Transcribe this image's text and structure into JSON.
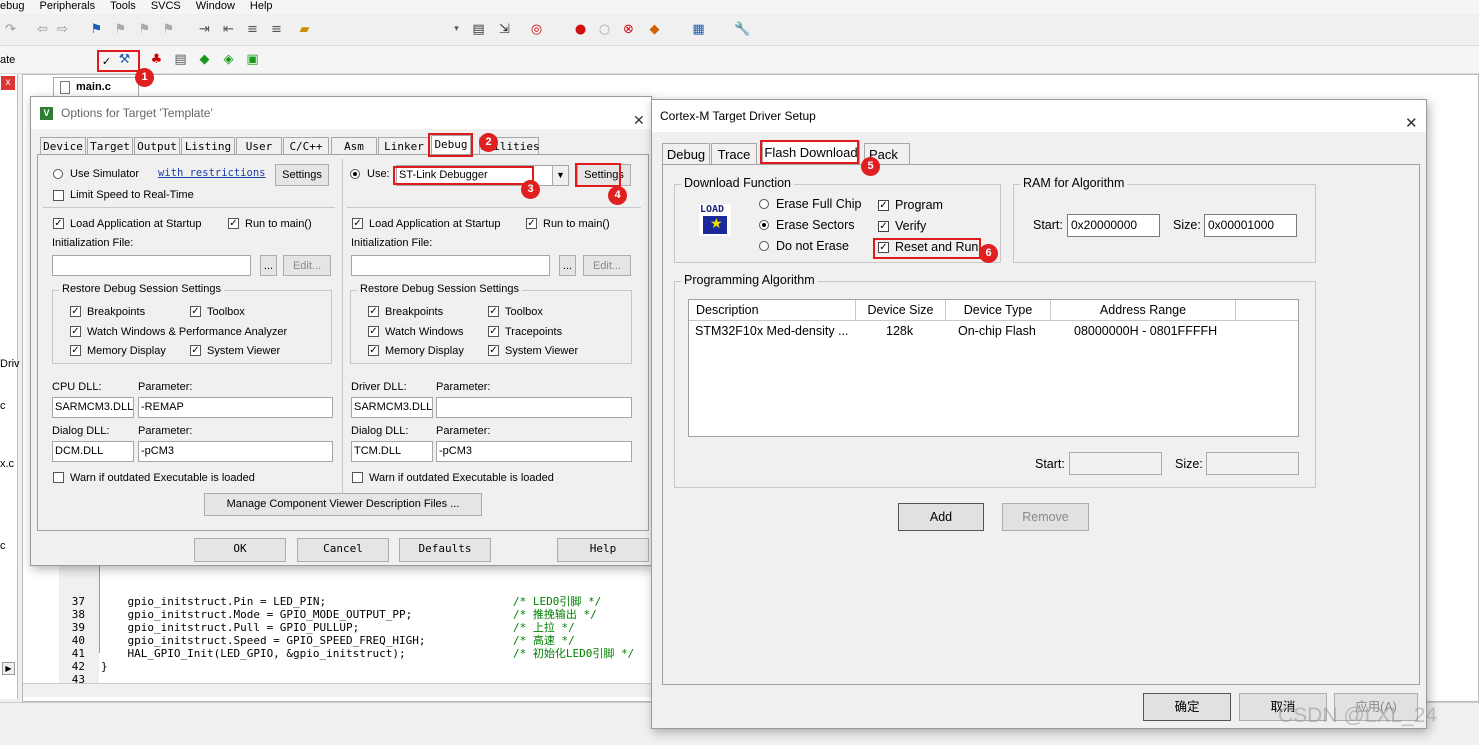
{
  "menu": [
    "ebug",
    "Peripherals",
    "Tools",
    "SVCS",
    "Window",
    "Help"
  ],
  "toolbar2": {
    "target_name": "ate"
  },
  "editor": {
    "tab_name": "main.c",
    "line_numbers": [
      "37",
      "38",
      "39",
      "40",
      "41",
      "42",
      "43"
    ],
    "code_lines": [
      "    gpio_initstruct.Pin = LED_PIN;",
      "    gpio_initstruct.Mode = GPIO_MODE_OUTPUT_PP;",
      "    gpio_initstruct.Pull = GPIO_PULLUP;",
      "    gpio_initstruct.Speed = GPIO_SPEED_FREQ_HIGH;",
      "    HAL_GPIO_Init(LED_GPIO, &gpio_initstruct);",
      "}",
      ""
    ],
    "comments": [
      "/* LED0引脚 */",
      "/* 推挽输出 */",
      "/* 上拉 */",
      "/* 高速 */",
      "/* 初始化LED0引脚 */"
    ],
    "left_fragments": [
      "Driv",
      "c",
      "x.c",
      "c"
    ]
  },
  "options_dialog": {
    "title": "Options for Target 'Template'",
    "tabs": [
      "Device",
      "Target",
      "Output",
      "Listing",
      "User",
      "C/C++",
      "Asm",
      "Linker",
      "Debug",
      "Utilities"
    ],
    "left": {
      "use_simulator": "Use Simulator",
      "with_restrictions": "with restrictions",
      "settings": "Settings",
      "limit_speed": "Limit Speed to Real-Time",
      "load_app": "Load Application at Startup",
      "run_to_main": "Run to main()",
      "init_file": "Initialization File:",
      "browse": "...",
      "edit": "Edit...",
      "restore": "Restore Debug Session Settings",
      "breakpoints": "Breakpoints",
      "toolbox": "Toolbox",
      "watch": "Watch Windows & Performance Analyzer",
      "memory": "Memory Display",
      "sysviewer": "System Viewer",
      "cpu_dll": "CPU DLL:",
      "parameter": "Parameter:",
      "cpu_dll_val": "SARMCM3.DLL",
      "cpu_param_val": "-REMAP",
      "dialog_dll": "Dialog DLL:",
      "dialog_dll_val": "DCM.DLL",
      "dialog_param_val": "-pCM3",
      "warn": "Warn if outdated Executable is loaded"
    },
    "right": {
      "use": "Use:",
      "debugger": "ST-Link Debugger",
      "settings": "Settings",
      "load_app": "Load Application at Startup",
      "run_to_main": "Run to main()",
      "init_file": "Initialization File:",
      "browse": "...",
      "edit": "Edit...",
      "restore": "Restore Debug Session Settings",
      "breakpoints": "Breakpoints",
      "toolbox": "Toolbox",
      "watch": "Watch Windows",
      "tracepoints": "Tracepoints",
      "memory": "Memory Display",
      "sysviewer": "System Viewer",
      "driver_dll": "Driver DLL:",
      "parameter": "Parameter:",
      "driver_dll_val": "SARMCM3.DLL",
      "driver_param_val": "",
      "dialog_dll": "Dialog DLL:",
      "dialog_dll_val": "TCM.DLL",
      "dialog_param_val": "-pCM3",
      "warn": "Warn if outdated Executable is loaded"
    },
    "manage": "Manage Component Viewer Description Files ...",
    "buttons": {
      "ok": "OK",
      "cancel": "Cancel",
      "defaults": "Defaults",
      "help": "Help"
    }
  },
  "cortex_dialog": {
    "title": "Cortex-M Target Driver Setup",
    "tabs": [
      "Debug",
      "Trace",
      "Flash Download",
      "Pack"
    ],
    "download_function": "Download Function",
    "load_icon": "LOAD",
    "erase_full": "Erase Full Chip",
    "erase_sectors": "Erase Sectors",
    "no_erase": "Do not Erase",
    "program": "Program",
    "verify": "Verify",
    "reset_run": "Reset and Run",
    "ram": "RAM for Algorithm",
    "start": "Start:",
    "start_val": "0x20000000",
    "size": "Size:",
    "size_val": "0x00001000",
    "prog_algo": "Programming Algorithm",
    "columns": [
      "Description",
      "Device Size",
      "Device Type",
      "Address Range"
    ],
    "rows": [
      {
        "description": "STM32F10x Med-density ...",
        "size": "128k",
        "type": "On-chip Flash",
        "range": "08000000H - 0801FFFFH"
      }
    ],
    "start2": "Start:",
    "size2": "Size:",
    "add": "Add",
    "remove": "Remove",
    "ok": "确定",
    "cancel": "取消",
    "apply": "应用(A)"
  },
  "badges": [
    "1",
    "2",
    "3",
    "4",
    "5",
    "6"
  ],
  "watermark": "CSDN @LXL_24"
}
